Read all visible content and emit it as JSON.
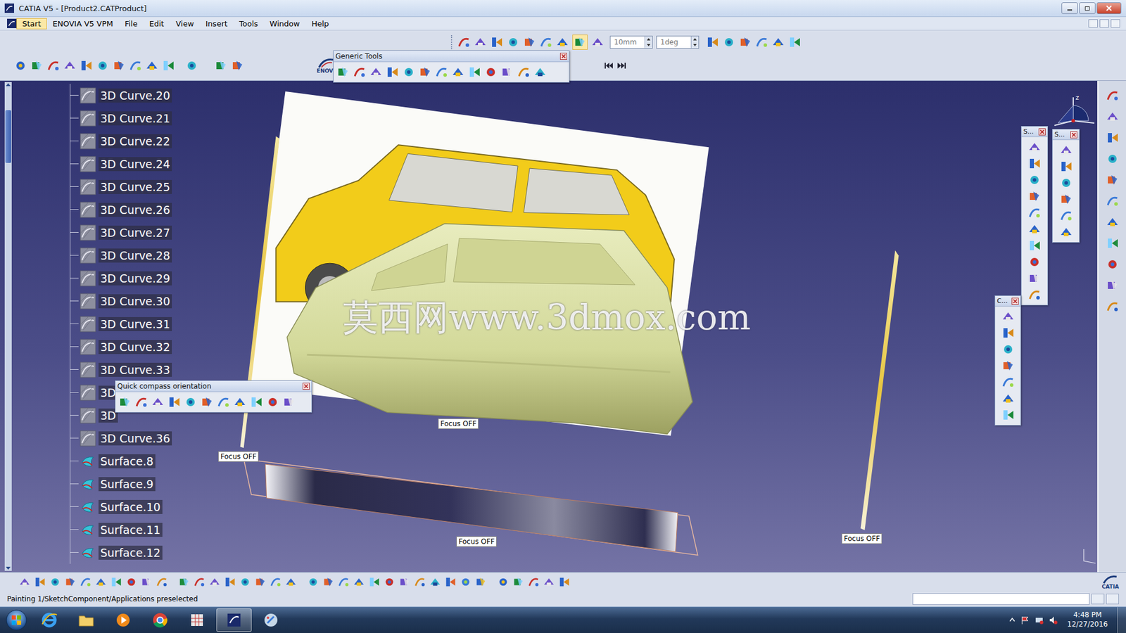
{
  "window": {
    "title": "CATIA V5 - [Product2.CATProduct]"
  },
  "menu": [
    {
      "label": "Start",
      "selected": true
    },
    {
      "label": "ENOVIA V5 VPM",
      "selected": false
    },
    {
      "label": "File",
      "selected": false
    },
    {
      "label": "Edit",
      "selected": false
    },
    {
      "label": "View",
      "selected": false
    },
    {
      "label": "Insert",
      "selected": false
    },
    {
      "label": "Tools",
      "selected": false
    },
    {
      "label": "Window",
      "selected": false
    },
    {
      "label": "Help",
      "selected": false
    }
  ],
  "toolbar": {
    "length_step": "10mm",
    "angle_step": "1deg",
    "logo_caption": "ENOVI"
  },
  "generic_tools": {
    "title": "Generic Tools"
  },
  "quick_compass": {
    "title": "Quick compass orientation"
  },
  "side_toolbars": [
    {
      "title": "S..."
    },
    {
      "title": "S..."
    },
    {
      "title": "C..."
    }
  ],
  "tree": [
    {
      "label": "3D Curve.20",
      "kind": "curve"
    },
    {
      "label": "3D Curve.21",
      "kind": "curve"
    },
    {
      "label": "3D Curve.22",
      "kind": "curve"
    },
    {
      "label": "3D Curve.24",
      "kind": "curve"
    },
    {
      "label": "3D Curve.25",
      "kind": "curve"
    },
    {
      "label": "3D Curve.26",
      "kind": "curve"
    },
    {
      "label": "3D Curve.27",
      "kind": "curve"
    },
    {
      "label": "3D Curve.28",
      "kind": "curve"
    },
    {
      "label": "3D Curve.29",
      "kind": "curve"
    },
    {
      "label": "3D Curve.30",
      "kind": "curve"
    },
    {
      "label": "3D Curve.31",
      "kind": "curve"
    },
    {
      "label": "3D Curve.32",
      "kind": "curve"
    },
    {
      "label": "3D Curve.33",
      "kind": "curve"
    },
    {
      "label": "3D",
      "kind": "curve"
    },
    {
      "label": "3D",
      "kind": "curve"
    },
    {
      "label": "3D Curve.36",
      "kind": "curve"
    },
    {
      "label": "Surface.8",
      "kind": "surface"
    },
    {
      "label": "Surface.9",
      "kind": "surface"
    },
    {
      "label": "Surface.10",
      "kind": "surface"
    },
    {
      "label": "Surface.11",
      "kind": "surface"
    },
    {
      "label": "Surface.12",
      "kind": "surface"
    }
  ],
  "viewport": {
    "watermark": "莫西网www.3dmox.com",
    "focus_labels": [
      "Focus OFF",
      "Focus OFF",
      "Focus OFF",
      "Focus OFF"
    ],
    "compass_axis": "z"
  },
  "status_bar": {
    "text": "Painting 1/SketchComponent/Applications preselected"
  },
  "brand": "CATIA",
  "taskbar": {
    "apps": [
      {
        "kind": "ie",
        "active": false
      },
      {
        "kind": "folder",
        "active": false
      },
      {
        "kind": "media",
        "active": false
      },
      {
        "kind": "chrome",
        "active": false
      },
      {
        "kind": "grid",
        "active": false
      },
      {
        "kind": "catia",
        "active": true
      },
      {
        "kind": "paint",
        "active": false
      }
    ],
    "time": "4:48 PM",
    "date": "12/27/2016"
  }
}
